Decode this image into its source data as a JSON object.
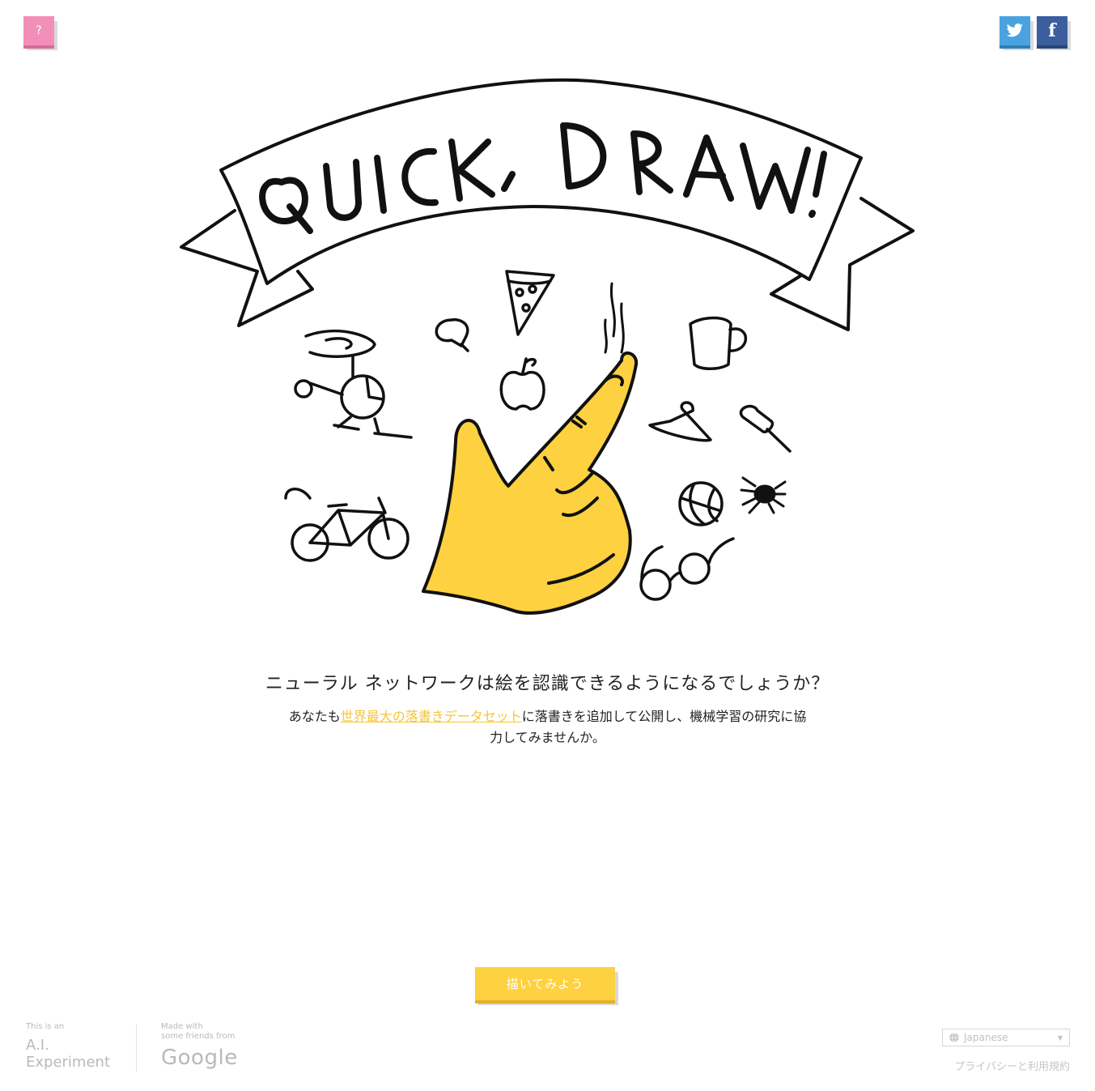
{
  "header": {
    "help_label": "?",
    "twitter_icon": "twitter-bird-icon",
    "facebook_label": "f"
  },
  "hero": {
    "title_art": "QUICK, DRAW!",
    "accent_color": "#fdd13f",
    "icons": [
      "helicopter-icon",
      "lightbulb-icon",
      "pizza-slice-icon",
      "apple-icon",
      "steam-icon",
      "mug-icon",
      "hanger-icon",
      "pushpin-icon",
      "basketball-icon",
      "spider-icon",
      "bicycle-icon",
      "eyeglasses-icon",
      "pointing-hand-icon"
    ]
  },
  "intro": {
    "headline": "ニューラル ネットワークは絵を認識できるようになるでしょうか？",
    "sub_prefix": "あなたも",
    "sub_link": "世界最大の落書きデータセット",
    "sub_suffix": "に落書きを追加して公開し、機械学習の研究に協力してみませんか。"
  },
  "start_button": {
    "label": "描いてみよう"
  },
  "footer": {
    "ai_line1": "This is an",
    "ai_line2": "A.I.",
    "ai_line3": "Experiment",
    "google_line1": "Made with",
    "google_line2": "some friends from",
    "google_word": "Google",
    "language": "Japanese",
    "privacy": "プライバシーと利用規約"
  }
}
